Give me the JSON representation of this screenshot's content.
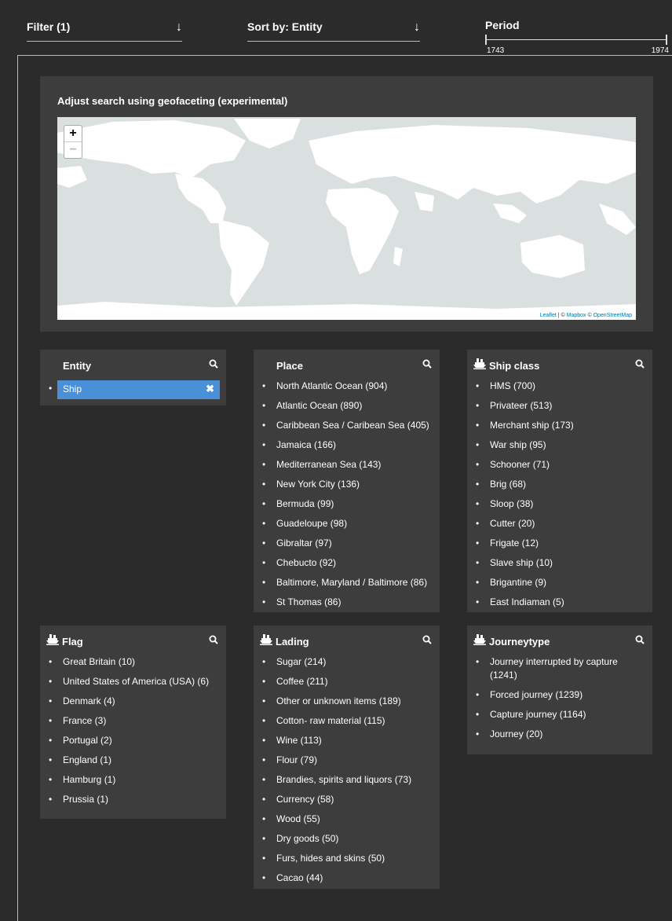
{
  "filters": {
    "filter_label": "Filter (1)",
    "sort_label": "Sort by: Entity"
  },
  "period": {
    "title": "Period",
    "min": "1743",
    "max": "1974"
  },
  "geo": {
    "title": "Adjust search using geofaceting (experimental)",
    "zoom_in": "+",
    "zoom_out": "−",
    "attribution": {
      "leaflet": "Leaflet",
      "sep1": " | © ",
      "mapbox": "Mapbox",
      "sep2": " © ",
      "osm": "OpenStreetMap"
    }
  },
  "entity": {
    "title": "Entity",
    "selected": "Ship",
    "remove": "✖"
  },
  "place": {
    "title": "Place",
    "items": [
      "North Atlantic Ocean (904)",
      "Atlantic Ocean (890)",
      "Caribbean Sea / Caribean Sea (405)",
      "Jamaica (166)",
      "Mediterranean Sea (143)",
      "New York City (136)",
      "Bermuda (99)",
      "Guadeloupe (98)",
      "Gibraltar (97)",
      "Chebucto (92)",
      "Baltimore, Maryland / Baltimore (86)",
      "St Thomas (86)"
    ]
  },
  "shipclass": {
    "title": "Ship class",
    "items": [
      "HMS (700)",
      "Privateer (513)",
      "Merchant ship (173)",
      "War ship (95)",
      "Schooner (71)",
      "Brig (68)",
      "Sloop (38)",
      "Cutter (20)",
      "Frigate (12)",
      "Slave ship (10)",
      "Brigantine (9)",
      "East Indiaman (5)"
    ]
  },
  "flag": {
    "title": "Flag",
    "items": [
      "Great Britain (10)",
      "United States of America (USA) (6)",
      "Denmark (4)",
      "France (3)",
      "Portugal (2)",
      "England (1)",
      "Hamburg (1)",
      "Prussia (1)"
    ]
  },
  "lading": {
    "title": "Lading",
    "items": [
      "Sugar (214)",
      "Coffee (211)",
      "Other or unknown items (189)",
      "Cotton- raw material (115)",
      "Wine (113)",
      "Flour (79)",
      "Brandies, spirits and liquors (73)",
      "Currency (58)",
      "Wood (55)",
      "Dry goods (50)",
      "Furs, hides and skins (50)",
      "Cacao (44)"
    ]
  },
  "journeytype": {
    "title": "Journeytype",
    "items": [
      "Journey interrupted by capture (1241)",
      "Forced journey (1239)",
      "Capture journey (1164)",
      "Journey (20)"
    ]
  }
}
